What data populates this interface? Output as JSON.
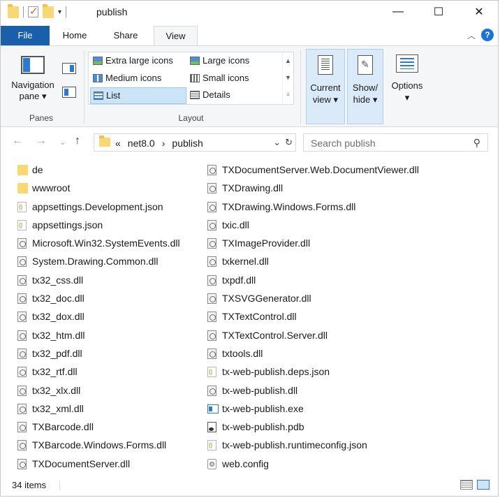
{
  "window": {
    "title": "publish",
    "minimize_icon": "—",
    "maximize_icon": "☐",
    "close_icon": "✕"
  },
  "ribbon": {
    "tabs": [
      "File",
      "Home",
      "Share",
      "View"
    ],
    "active_tab": "View",
    "panes": {
      "label": "Panes",
      "navigation_pane": "Navigation pane ▾"
    },
    "layout": {
      "label": "Layout",
      "options": [
        "Extra large icons",
        "Large icons",
        "Medium icons",
        "Small icons",
        "List",
        "Details"
      ],
      "selected": "List"
    },
    "current_view": "Current view ▾",
    "show_hide": "Show/ hide ▾",
    "options": "Options",
    "options_arrow": "▾"
  },
  "addressbar": {
    "overflow": "«",
    "path": [
      "net8.0",
      "publish"
    ],
    "separator": "›",
    "search_placeholder": "Search publish"
  },
  "files_left": [
    {
      "name": "de",
      "type": "folder"
    },
    {
      "name": "wwwroot",
      "type": "folder"
    },
    {
      "name": "appsettings.Development.json",
      "type": "json"
    },
    {
      "name": "appsettings.json",
      "type": "json"
    },
    {
      "name": "Microsoft.Win32.SystemEvents.dll",
      "type": "dll"
    },
    {
      "name": "System.Drawing.Common.dll",
      "type": "dll"
    },
    {
      "name": "tx32_css.dll",
      "type": "dll"
    },
    {
      "name": "tx32_doc.dll",
      "type": "dll"
    },
    {
      "name": "tx32_dox.dll",
      "type": "dll"
    },
    {
      "name": "tx32_htm.dll",
      "type": "dll"
    },
    {
      "name": "tx32_pdf.dll",
      "type": "dll"
    },
    {
      "name": "tx32_rtf.dll",
      "type": "dll"
    },
    {
      "name": "tx32_xlx.dll",
      "type": "dll"
    },
    {
      "name": "tx32_xml.dll",
      "type": "dll"
    },
    {
      "name": "TXBarcode.dll",
      "type": "dll"
    },
    {
      "name": "TXBarcode.Windows.Forms.dll",
      "type": "dll"
    },
    {
      "name": "TXDocumentServer.dll",
      "type": "dll"
    }
  ],
  "files_right": [
    {
      "name": "TXDocumentServer.Web.DocumentViewer.dll",
      "type": "dll"
    },
    {
      "name": "TXDrawing.dll",
      "type": "dll"
    },
    {
      "name": "TXDrawing.Windows.Forms.dll",
      "type": "dll"
    },
    {
      "name": "txic.dll",
      "type": "dll"
    },
    {
      "name": "TXImageProvider.dll",
      "type": "dll"
    },
    {
      "name": "txkernel.dll",
      "type": "dll"
    },
    {
      "name": "txpdf.dll",
      "type": "dll"
    },
    {
      "name": "TXSVGGenerator.dll",
      "type": "dll"
    },
    {
      "name": "TXTextControl.dll",
      "type": "dll"
    },
    {
      "name": "TXTextControl.Server.dll",
      "type": "dll"
    },
    {
      "name": "txtools.dll",
      "type": "dll"
    },
    {
      "name": "tx-web-publish.deps.json",
      "type": "json"
    },
    {
      "name": "tx-web-publish.dll",
      "type": "dll"
    },
    {
      "name": "tx-web-publish.exe",
      "type": "exe"
    },
    {
      "name": "tx-web-publish.pdb",
      "type": "pdb"
    },
    {
      "name": "tx-web-publish.runtimeconfig.json",
      "type": "json"
    },
    {
      "name": "web.config",
      "type": "config"
    }
  ],
  "status": {
    "item_count": "34 items"
  }
}
